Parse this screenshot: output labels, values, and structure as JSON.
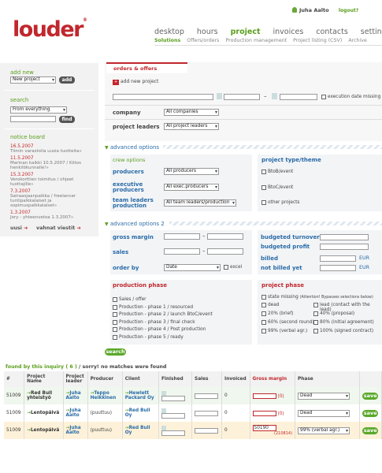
{
  "header": {
    "logo": "louder",
    "logo_reg": "®",
    "user_name": "Juha Aalto",
    "logout": "logout?",
    "nav": [
      "desktop",
      "hours",
      "project",
      "invoices",
      "contacts",
      "settings"
    ],
    "subnav": [
      "Solutions",
      "Offers/orders",
      "Production management",
      "Project listing (CSV)",
      "Archive"
    ]
  },
  "sidebar": {
    "add_new_title": "add new",
    "add_new_select": "New project",
    "add_button": "add",
    "search_title": "search",
    "search_select": "From everything",
    "find_button": "find",
    "notice_title": "notice board",
    "notices": [
      {
        "date": "16.5.2007",
        "text": "Tiimin varastolla uusia tuotteita»"
      },
      {
        "date": "11.5.2007",
        "text": "Marinan kaikki 10.5.2007 / Kiitos henkilökunnalle!»"
      },
      {
        "date": "15.3.2007",
        "text": "Verokorttien toimitus / ohjeet tuottajille»"
      },
      {
        "date": "7.3.2007",
        "text": "Sairaasjaanpalkka / freelancer tuntipalkkalaiset ja sopimuspalkkalaiset»"
      },
      {
        "date": "1.3.2007",
        "text": "Jory - yhteenvetoa 1.3.2007»"
      }
    ],
    "new_label": "uusi",
    "old_label": "vahnat viestit"
  },
  "orders": {
    "tab": "orders & offers",
    "add_project": "add new project",
    "execution_missing": "execution date missing",
    "company_label": "company",
    "company_select": "All companies",
    "leaders_label": "project leaders",
    "leaders_select": "All project leaders"
  },
  "advanced": {
    "title": "advanced options",
    "crew_label": "crew",
    "crew_options": "options",
    "producers_label": "producers",
    "producers_select": "All producers",
    "exec_label": "executive producers",
    "exec_select": "All exec.producers",
    "team_label": "team leaders production",
    "team_select": "All team leaders/production",
    "type_title": "project type/theme",
    "types": [
      "BtoB/event",
      "BtoC/event",
      "other projects"
    ]
  },
  "advanced2": {
    "title": "advanced options 2",
    "gross_margin": "gross margin",
    "sales": "sales",
    "order_by": "order by",
    "order_select": "Date",
    "excel": "excel",
    "budgeted_turnover": "budgeted turnover",
    "budgeted_profit": "budgeted profit",
    "billed": "billed",
    "not_billed": "not billed yet",
    "eur": "EUR"
  },
  "production_phase": {
    "title": "production phase",
    "items": [
      "Sales / offer",
      "Production - phase 1 / resourced",
      "Production - phase 2 / launch BtoC/event",
      "Production - phase 3 / final check",
      "Production - phase 4 / Post production",
      "Production - phase 5 / ready"
    ]
  },
  "project_phase": {
    "title": "project phase",
    "state_missing": "state missing",
    "attention": "(Attention! Bypasses selections below)",
    "left": [
      "dead",
      "20% (brief)",
      "60% (second round)",
      "99% (verbal agr.)"
    ],
    "right": [
      "lead (contact with the lead)",
      "40% (proposal)",
      "80% (initial agreement)",
      "100% (signed contract)"
    ]
  },
  "search_button": "search",
  "results": {
    "found": "found by this inquiry ( 6 )",
    "sorry": " / sorry! no matches were found",
    "columns": [
      "#",
      "Project Name",
      "Project leader",
      "Producer",
      "Client",
      "Finished",
      "Sales",
      "Invoiced",
      "Gross margin",
      "Phase",
      ""
    ],
    "rows": [
      {
        "num": "51009",
        "name": "Red Bull yhteistyö",
        "leader": "Juha Aalto",
        "producer": "Teppo Heikkinen",
        "client": "Hewlett Packard Oy",
        "invoiced": "0",
        "gross": "",
        "gross_note": "(0)",
        "phase": "Dead",
        "save": "save"
      },
      {
        "num": "51009",
        "name": "Lentopäivä",
        "leader": "Juha Aalto",
        "producer": "(puuttuu)",
        "client": "Red Bull Oy",
        "invoiced": "0",
        "gross": "",
        "gross_note": "(0)",
        "phase": "Dead",
        "save": "save"
      },
      {
        "num": "51009",
        "name": "Lentopäivä",
        "leader": "Juha Aalto",
        "producer": "(puuttuu)",
        "client": "Red Bull Oy",
        "invoiced": "0",
        "gross": "50190",
        "gross_note": "(210814)",
        "phase": "99% (verbal agr.)",
        "save": "save"
      }
    ]
  }
}
